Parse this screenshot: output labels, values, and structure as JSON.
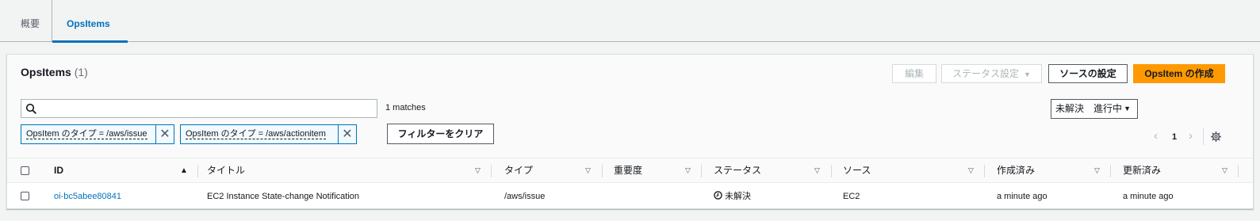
{
  "tabs": [
    {
      "label": "概要"
    },
    {
      "label": "OpsItems"
    }
  ],
  "panel": {
    "title": "OpsItems",
    "count": "(1)",
    "buttons": {
      "edit": "編集",
      "status": "ステータス設定",
      "source": "ソースの設定",
      "create": "OpsItem の作成"
    },
    "search": {
      "value": "",
      "placeholder": ""
    },
    "matches": "1 matches",
    "status_filter": "未解決　進行中",
    "tokens": [
      {
        "label": "OpsItem のタイプ = /aws/issue"
      },
      {
        "label": "OpsItem のタイプ = /aws/actionitem"
      }
    ],
    "clear_filters": "フィルターをクリア",
    "pagination": {
      "prev": "‹",
      "page": "1",
      "next": "›"
    }
  },
  "table": {
    "columns": [
      "ID",
      "タイトル",
      "タイプ",
      "重要度",
      "ステータス",
      "ソース",
      "作成済み",
      "更新済み"
    ],
    "rows": [
      {
        "id": "oi-bc5abee80841",
        "title": "EC2 Instance State-change Notification",
        "type": "/aws/issue",
        "severity": "",
        "status": "未解決",
        "source": "EC2",
        "created": "a minute ago",
        "updated": "a minute ago"
      }
    ]
  },
  "colors": {
    "accent": "#0073bb",
    "primary_button": "#ff9900",
    "background": "#f2f3f3"
  },
  "icons": [
    "search-icon",
    "close-icon",
    "caret-down-icon",
    "sort-ascending-icon",
    "sort-icon",
    "clock-icon",
    "gear-icon",
    "chevron-left-icon",
    "chevron-right-icon"
  ]
}
